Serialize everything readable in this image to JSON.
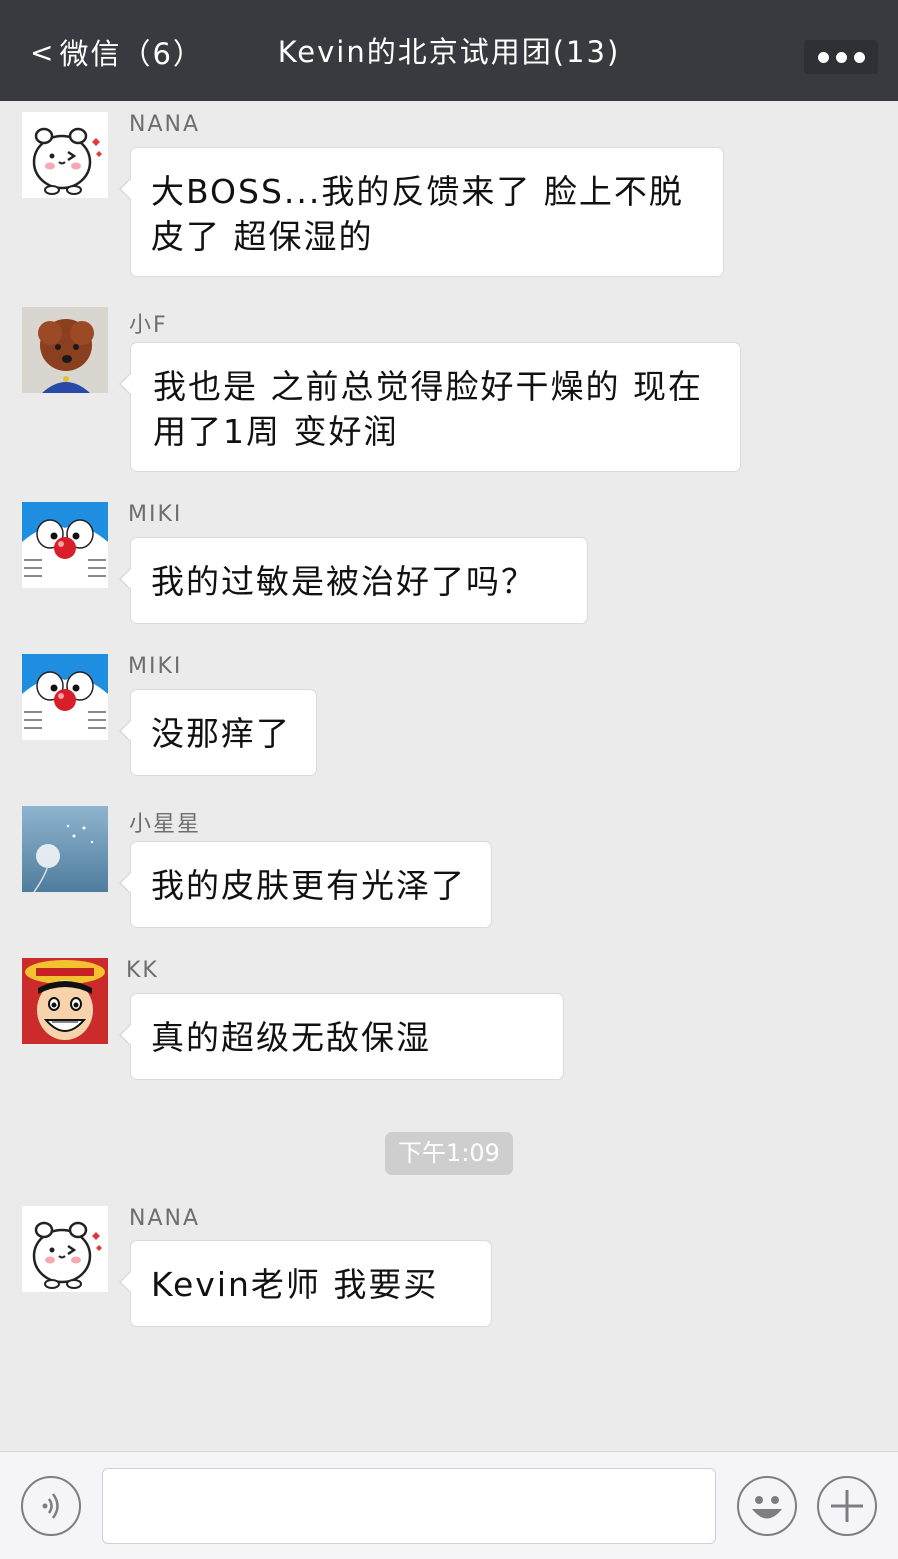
{
  "header": {
    "back_label": "微信（6）",
    "title": "Kevin的北京试用团(13)"
  },
  "messages": [
    {
      "sender": "NANA",
      "avatar": "bear-avatar",
      "text": "大BOSS...我的反馈来了 脸上不脱皮了 超保湿的"
    },
    {
      "sender": "小F",
      "avatar": "poodle-avatar",
      "text": "我也是 之前总觉得脸好干燥的 现在用了1周 变好润"
    },
    {
      "sender": "MIKI",
      "avatar": "doraemon-avatar",
      "text": "我的过敏是被治好了吗？"
    },
    {
      "sender": "MIKI",
      "avatar": "doraemon-avatar",
      "text": "没那痒了"
    },
    {
      "sender": "小星星",
      "avatar": "dandelion-avatar",
      "text": "我的皮肤更有光泽了"
    },
    {
      "sender": "KK",
      "avatar": "luffy-avatar",
      "text": "真的超级无敌保湿"
    },
    {
      "sender": "NANA",
      "avatar": "bear-avatar",
      "text": "Kevin老师 我要买"
    }
  ],
  "timestamp": "下午1:09",
  "input": {
    "value": "",
    "placeholder": ""
  },
  "icons": {
    "back": "chevron-left-icon",
    "more": "more-dots-icon",
    "voice": "voice-icon",
    "emoji": "emoji-icon",
    "plus": "plus-icon"
  },
  "colors": {
    "header_bg": "#393a3f",
    "chat_bg": "#ebebeb",
    "bubble_bg": "#ffffff"
  }
}
